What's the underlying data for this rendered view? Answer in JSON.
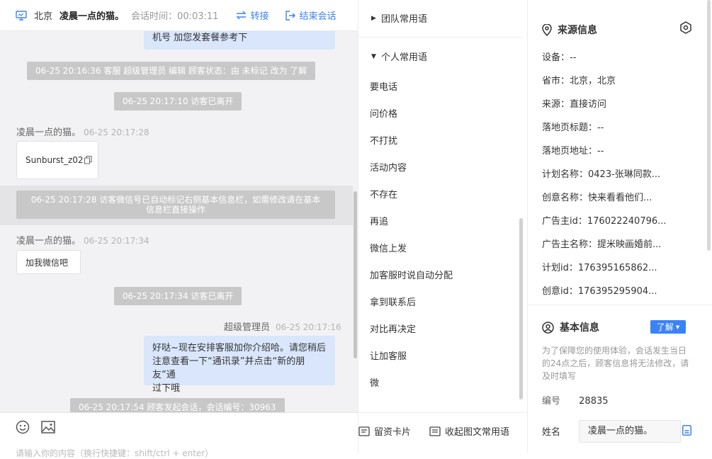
{
  "header": {
    "city": "北京",
    "visitor_name": "凌晨一点的猫。",
    "session_time_label": "会话时间：",
    "session_time": "00:03:11",
    "transfer_label": "转接",
    "end_label": "结束会话"
  },
  "messages": {
    "top_bubble_text": "机号 加您发套餐参考下",
    "sys1": "06-25 20:16:36 客服 超级管理员 编辑 顾客状态：由 未标记 改为 了解",
    "sys2": "06-25 20:17:10 访客已离开",
    "msg1_name": "凌晨一点的猫。",
    "msg1_time": "06-25 20:17:28",
    "msg1_file": "Sunburst_z02",
    "sys3_line1": "06-25 20:17:28 访客微信号已自动标记右侧基本信息栏，如需修改请在基本",
    "sys3_line2": "信息栏直接操作",
    "msg2_name": "凌晨一点的猫。",
    "msg2_time": "06-25 20:17:34",
    "msg2_text": "加我微信吧",
    "sys4": "06-25 20:17:34 访客已离开",
    "agent_name": "超级管理员",
    "agent_time": "06-25 20:17:16",
    "agent_line1": "好哒~现在安排客服加你介绍哈。请您稍后",
    "agent_line2": "注意查看一下“通讯录”并点击“新的朋友”通",
    "agent_line3": "过下哦",
    "sys5": "06-25 20:17:54 顾客发起会话，会话编号：30963"
  },
  "input": {
    "placeholder": "请输入你的内容（换行快捷键：shift/ctrl + enter）"
  },
  "phrases": {
    "team_group": "团队常用语",
    "personal_group": "个人常用语",
    "items": [
      "要电话",
      "问价格",
      "不打扰",
      "活动内容",
      "不存在",
      "再追",
      "微信上发",
      "加客服时说自动分配",
      "拿到联系后",
      "对比再决定",
      "让加客服",
      "微"
    ],
    "footer_card": "留资卡片",
    "footer_collapse": "收起图文常用语"
  },
  "source_info": {
    "title": "来源信息",
    "rows": [
      {
        "label": "设备：",
        "value": "--"
      },
      {
        "label": "省市：",
        "value": "北京，北京"
      },
      {
        "label": "来源：",
        "value": "直接访问"
      },
      {
        "label": "落地页标题：",
        "value": "--"
      },
      {
        "label": "落地页地址：",
        "value": "--"
      },
      {
        "label": "计划名称：",
        "value": "0423-张琳同款..."
      },
      {
        "label": "创意名称：",
        "value": "快来看看他们..."
      },
      {
        "label": "广告主id：",
        "value": "176022240796..."
      },
      {
        "label": "广告主名称：",
        "value": "提米映画婚前..."
      },
      {
        "label": "计划id：",
        "value": "176395165862..."
      },
      {
        "label": "创意id：",
        "value": "176395295904..."
      }
    ]
  },
  "basic_info": {
    "title": "基本信息",
    "status_button": "了解",
    "notice": "为了保障您的使用体验，会话发生当日的24点之后，顾客信息将无法修改，请及时填写",
    "id_label": "编号",
    "id_value": "28835",
    "name_label": "姓名",
    "name_value": "凌晨一点的猫。"
  },
  "colors": {
    "accent": "#3b82f6",
    "system_message_bg": "#c8c8c8",
    "agent_bubble_bg": "#d9e6fc",
    "chat_bg": "#f2f2f4"
  }
}
